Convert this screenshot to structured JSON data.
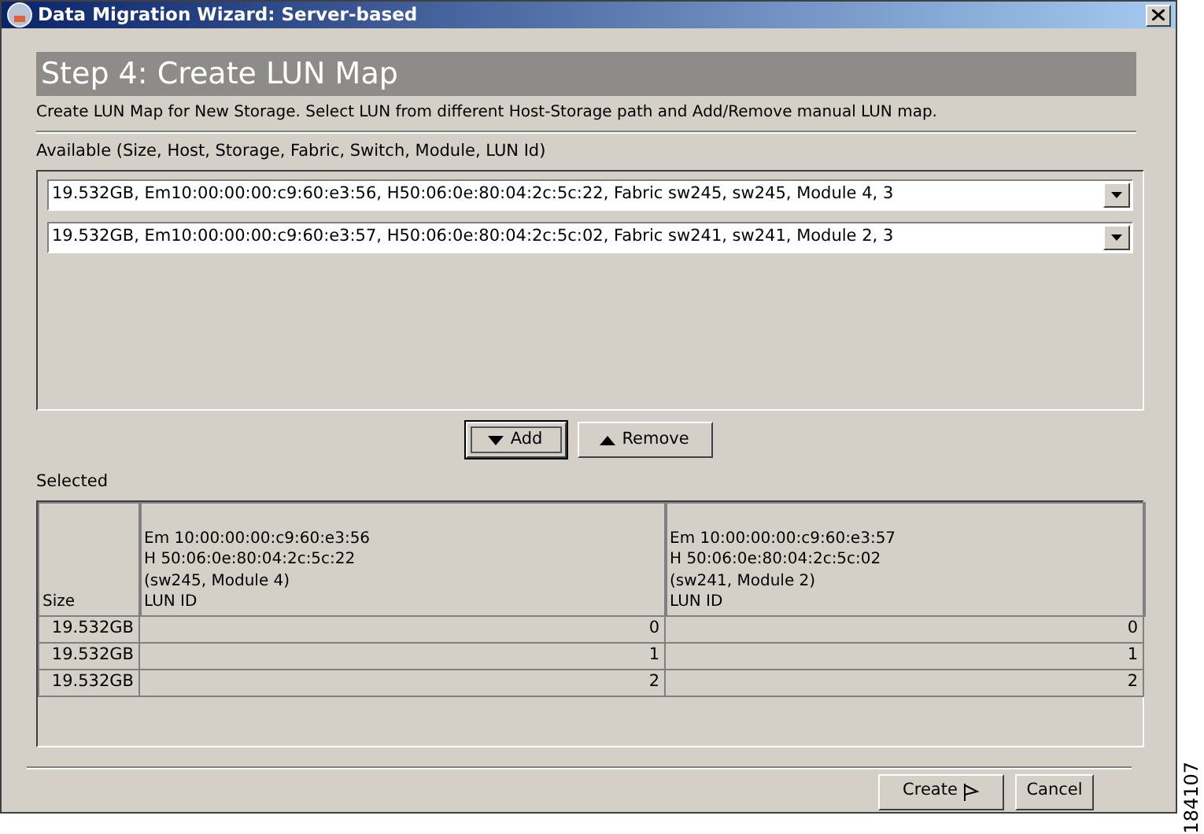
{
  "window": {
    "title": "Data Migration Wizard: Server-based"
  },
  "step": {
    "title": "Step 4: Create LUN Map",
    "description": "Create LUN Map for New Storage. Select LUN from different Host-Storage path and Add/Remove manual LUN map."
  },
  "available": {
    "label": "Available (Size, Host, Storage, Fabric, Switch, Module, LUN Id)",
    "items": [
      {
        "value": "19.532GB, Em10:00:00:00:c9:60:e3:56, H50:06:0e:80:04:2c:5c:22, Fabric sw245, sw245, Module 4, 3"
      },
      {
        "value": "19.532GB, Em10:00:00:00:c9:60:e3:57, H50:06:0e:80:04:2c:5c:02, Fabric sw241, sw241, Module 2, 3"
      }
    ]
  },
  "move_buttons": [
    {
      "label": "Add",
      "kind": "down",
      "focused": true
    },
    {
      "label": "Remove",
      "kind": "up",
      "focused": false
    }
  ],
  "selected": {
    "label": "Selected",
    "columns": [
      {
        "lines": [
          "Size"
        ]
      },
      {
        "lines": [
          "Em 10:00:00:00:c9:60:e3:56",
          "H 50:06:0e:80:04:2c:5c:22",
          "(sw245, Module 4)",
          "LUN ID"
        ]
      },
      {
        "lines": [
          "Em 10:00:00:00:c9:60:e3:57",
          "H 50:06:0e:80:04:2c:5c:02",
          "(sw241, Module 2)",
          "LUN ID"
        ]
      }
    ],
    "rows": [
      [
        "19.532GB",
        "0",
        "0"
      ],
      [
        "19.532GB",
        "1",
        "1"
      ],
      [
        "19.532GB",
        "2",
        "2"
      ]
    ]
  },
  "footer_buttons": [
    {
      "label": "Create",
      "kind": "create"
    },
    {
      "label": "Cancel",
      "kind": "plain"
    }
  ],
  "figure_number": "184107"
}
